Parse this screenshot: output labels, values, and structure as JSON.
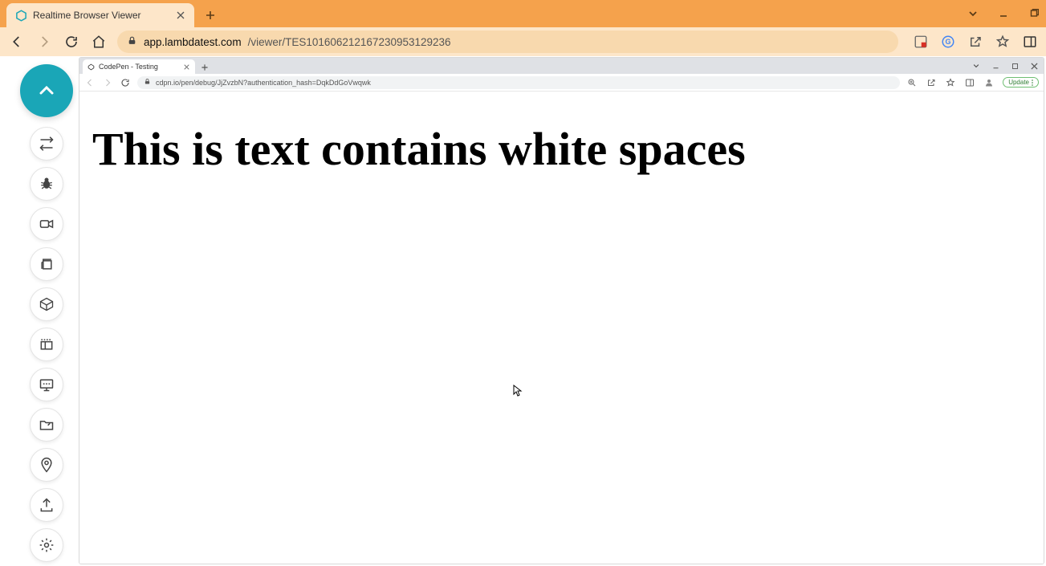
{
  "outer_browser": {
    "tab": {
      "title": "Realtime Browser Viewer",
      "favicon_color": "#1aa6b7"
    },
    "address": {
      "domain": "app.lambdatest.com",
      "path": "/viewer/TES101606212167230953129236"
    },
    "window_controls": {
      "dropdown": "⌄",
      "minimize": "—",
      "maximize": "▢"
    },
    "toolbar_icons": {
      "translate_badge": "red",
      "google": "G"
    }
  },
  "sidebar": {
    "items": [
      {
        "name": "collapse",
        "icon": "chevron-up"
      },
      {
        "name": "switch",
        "icon": "switch"
      },
      {
        "name": "bug",
        "icon": "bug"
      },
      {
        "name": "record",
        "icon": "video"
      },
      {
        "name": "gallery",
        "icon": "layers"
      },
      {
        "name": "cube",
        "icon": "cube"
      },
      {
        "name": "panel",
        "icon": "panel"
      },
      {
        "name": "monitor",
        "icon": "monitor"
      },
      {
        "name": "folder",
        "icon": "folder"
      },
      {
        "name": "location",
        "icon": "location"
      },
      {
        "name": "upload",
        "icon": "upload"
      },
      {
        "name": "settings",
        "icon": "gear"
      }
    ]
  },
  "inner_browser": {
    "tab": {
      "title": "CodePen - Testing"
    },
    "address": {
      "url": "cdpn.io/pen/debug/JjZvzbN?authentication_hash=DqkDdGoVwqwk"
    },
    "update_label": "Update",
    "page_heading": "This is text contains white spaces"
  }
}
